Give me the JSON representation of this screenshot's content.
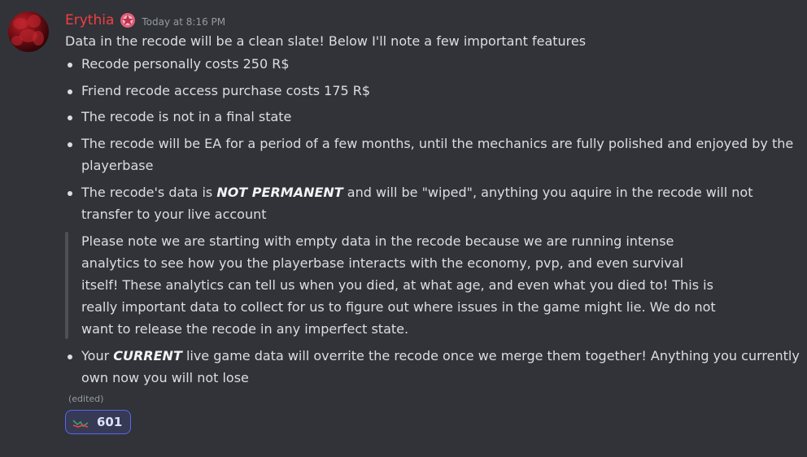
{
  "message": {
    "username": "Erythia",
    "timestamp": "Today at 8:16 PM",
    "intro": "Data in the recode will be a clean slate! Below I'll note a few important features",
    "bullets": [
      {
        "text": "Recode personally costs 250 R$"
      },
      {
        "text": "Friend recode access purchase costs 175 R$"
      },
      {
        "text": "The recode is not in a final state"
      },
      {
        "text": "The recode will be EA for a period of a few months, until the mechanics are fully polished and enjoyed by the playerbase"
      },
      {
        "before": "The recode's data is ",
        "emphasis": "NOT PERMANENT",
        "after": " and will be \"wiped\", anything you aquire in the recode will not transfer to your live account"
      }
    ],
    "quote": "Please note we are starting with empty data in the recode because we are running intense analytics to see how you the playerbase interacts with the economy, pvp, and even survival itself! These analytics can tell us when you died, at what age, and even what you died to! This is really important data to collect for us to figure out where issues in the game might lie. We do not want to release the recode in any imperfect state.",
    "last_bullet": {
      "before": "Your ",
      "emphasis": "CURRENT",
      "after": " live game data will overrite the recode once we merge them together! Anything you currently own now you will not lose"
    },
    "edited_label": "(edited)",
    "reaction": {
      "emoji": "graph-emoji",
      "count": "601"
    }
  },
  "colors": {
    "background": "#313338",
    "username": "#f23f42",
    "reaction_border": "#5865f2",
    "reaction_bg": "#373a54"
  }
}
